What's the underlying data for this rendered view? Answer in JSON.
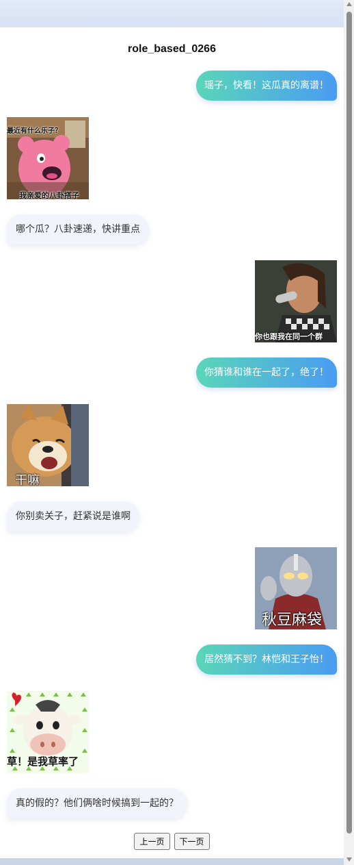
{
  "title": "role_based_0266",
  "messages": [
    {
      "side": "right",
      "type": "text",
      "text": "瑶子，快看！这瓜真的离谱！"
    },
    {
      "side": "left",
      "type": "sticker",
      "icon": "pink-bear-sticker",
      "caption_top": "最近有什么乐子？",
      "caption_bottom": "我亲爱的八卦搭子"
    },
    {
      "side": "left",
      "type": "text",
      "text": "哪个瓜？八卦速递，快讲重点"
    },
    {
      "side": "right",
      "type": "sticker",
      "icon": "singer-sticker",
      "caption_bottom": "你也跟我在同一个群"
    },
    {
      "side": "right",
      "type": "text",
      "text": "你猜谁和谁在一起了，绝了！"
    },
    {
      "side": "left",
      "type": "sticker",
      "icon": "shiba-dog-sticker",
      "caption_bottom": "干嘛"
    },
    {
      "side": "left",
      "type": "text",
      "text": "你别卖关子，赶紧说是谁啊"
    },
    {
      "side": "right",
      "type": "sticker",
      "icon": "ultraman-sticker",
      "caption_bottom": "秋豆麻袋"
    },
    {
      "side": "right",
      "type": "text",
      "text": "居然猜不到？林恺和王子怡！"
    },
    {
      "side": "left",
      "type": "sticker",
      "icon": "cow-sticker",
      "caption_bottom": "草！是我草率了"
    },
    {
      "side": "left",
      "type": "text",
      "text": "真的假的？他们俩啥时候搞到一起的？"
    }
  ],
  "pager": {
    "prev": "上一页",
    "next": "下一页"
  }
}
